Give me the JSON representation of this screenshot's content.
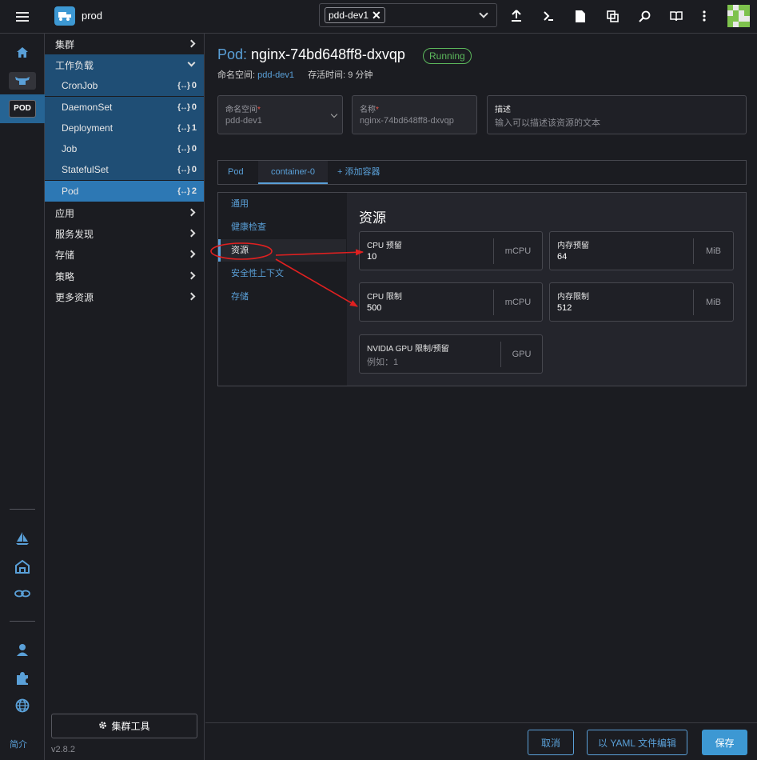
{
  "header": {
    "cluster_name": "prod",
    "namespace_chip": "pdd-dev1",
    "chip_remove": "✕",
    "icons": [
      "hamburger-icon",
      "cluster-logo-icon",
      "upload-icon",
      "terminal-icon",
      "file-icon",
      "copy-icon",
      "search-icon",
      "book-icon",
      "kebab-icon",
      "user-avatar"
    ]
  },
  "rail": {
    "pod_badge": "POD",
    "footer_link": "简介"
  },
  "sidebar": {
    "items": [
      {
        "label": "集群",
        "type": "group"
      },
      {
        "label": "工作负载",
        "type": "group-open"
      },
      {
        "label": "CronJob",
        "count": "0"
      },
      {
        "label": "DaemonSet",
        "count": "0"
      },
      {
        "label": "Deployment",
        "count": "1"
      },
      {
        "label": "Job",
        "count": "0"
      },
      {
        "label": "StatefulSet",
        "count": "0"
      },
      {
        "label": "Pod",
        "count": "2",
        "active": true
      },
      {
        "label": "应用",
        "type": "group"
      },
      {
        "label": "服务发现",
        "type": "group"
      },
      {
        "label": "存储",
        "type": "group"
      },
      {
        "label": "策略",
        "type": "group"
      },
      {
        "label": "更多资源",
        "type": "group"
      }
    ],
    "count_icon": "{↔}",
    "tools_button": "集群工具",
    "version": "v2.8.2"
  },
  "page": {
    "kind": "Pod:",
    "name": "nginx-74bd648ff8-dxvqp",
    "status": "Running",
    "ns_label": "命名空间:",
    "ns_value": "pdd-dev1",
    "age_label": "存活时间:",
    "age_value": "9 分钟"
  },
  "form": {
    "namespace": {
      "label": "命名空间",
      "req": "*",
      "value": "pdd-dev1"
    },
    "name": {
      "label": "名称",
      "req": "*",
      "value": "nginx-74bd648ff8-dxvqp"
    },
    "description": {
      "label": "描述",
      "placeholder": "输入可以描述该资源的文本"
    }
  },
  "tabs": {
    "pod": "Pod",
    "container": "container-0",
    "add": "+ 添加容器"
  },
  "subnav": [
    "通用",
    "健康检查",
    "资源",
    "安全性上下文",
    "存储"
  ],
  "resources": {
    "heading": "资源",
    "cpu_request": {
      "label": "CPU 预留",
      "value": "10",
      "unit": "mCPU"
    },
    "mem_request": {
      "label": "内存预留",
      "value": "64",
      "unit": "MiB"
    },
    "cpu_limit": {
      "label": "CPU 限制",
      "value": "500",
      "unit": "mCPU"
    },
    "mem_limit": {
      "label": "内存限制",
      "value": "512",
      "unit": "MiB"
    },
    "gpu": {
      "label": "NVIDIA GPU 限制/预留",
      "placeholder": "例如：1",
      "unit": "GPU"
    }
  },
  "footer": {
    "cancel": "取消",
    "yaml": "以 YAML 文件编辑",
    "save": "保存"
  },
  "colors": {
    "accent": "#3d98d3",
    "link": "#5aa0d8",
    "running": "#5cb85c",
    "annotation": "#e02020"
  }
}
